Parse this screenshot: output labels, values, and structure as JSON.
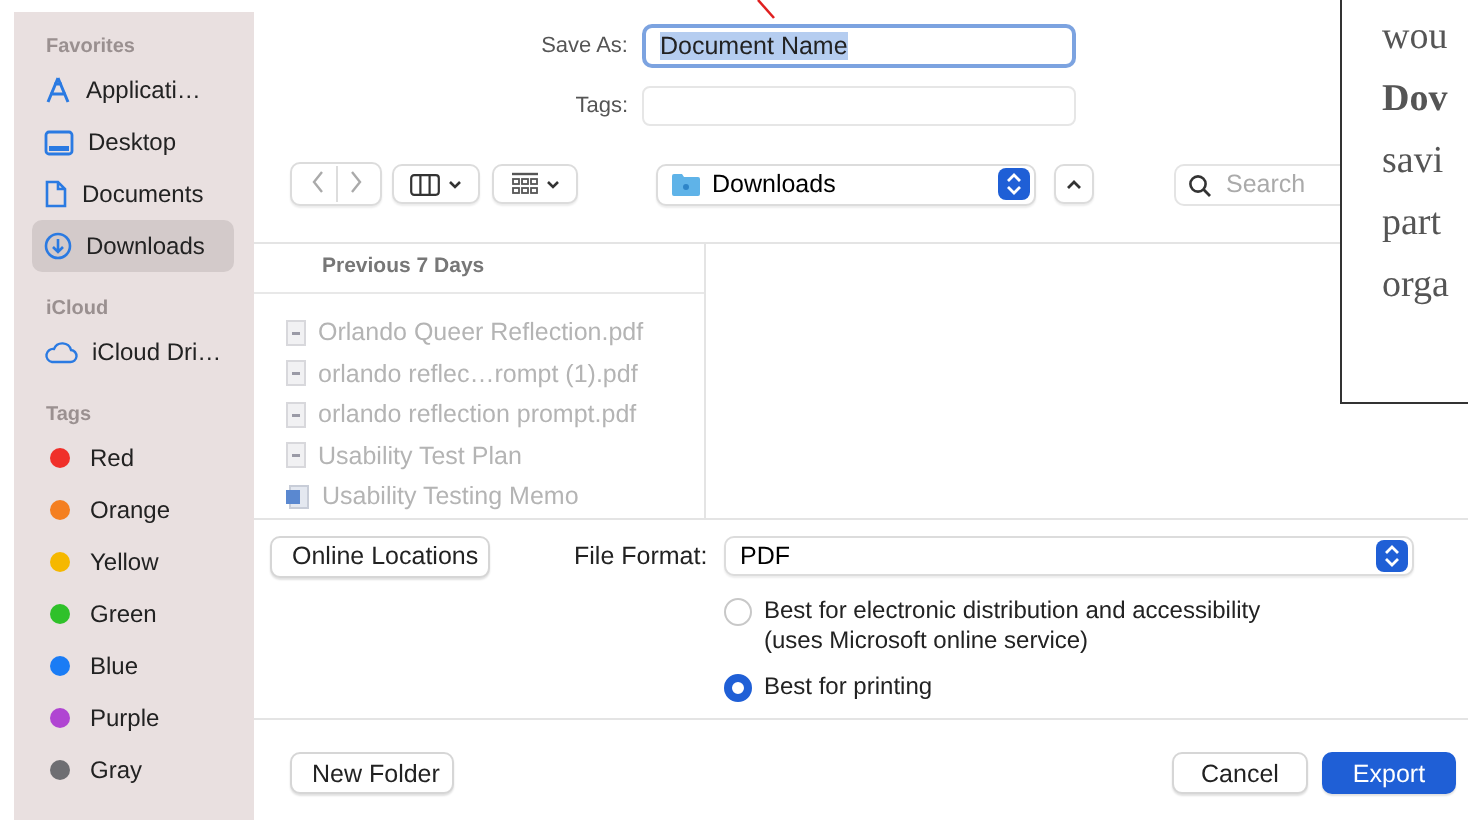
{
  "sidebar": {
    "sections": [
      {
        "title": "Favorites",
        "items": [
          {
            "label": "Applicati…",
            "kind": "apps",
            "selected": false
          },
          {
            "label": "Desktop",
            "kind": "desktop",
            "selected": false
          },
          {
            "label": "Documents",
            "kind": "doc",
            "selected": false
          },
          {
            "label": "Downloads",
            "kind": "download",
            "selected": true
          }
        ]
      },
      {
        "title": "iCloud",
        "items": [
          {
            "label": "iCloud Dri…",
            "kind": "cloud",
            "selected": false
          }
        ]
      },
      {
        "title": "Tags",
        "items": [
          {
            "label": "Red",
            "kind": "tag",
            "color": "#f0302a",
            "selected": false
          },
          {
            "label": "Orange",
            "kind": "tag",
            "color": "#f47f20",
            "selected": false
          },
          {
            "label": "Yellow",
            "kind": "tag",
            "color": "#f5b800",
            "selected": false
          },
          {
            "label": "Green",
            "kind": "tag",
            "color": "#2fc12a",
            "selected": false
          },
          {
            "label": "Blue",
            "kind": "tag",
            "color": "#1a7cf5",
            "selected": false
          },
          {
            "label": "Purple",
            "kind": "tag",
            "color": "#b045d2",
            "selected": false
          },
          {
            "label": "Gray",
            "kind": "tag",
            "color": "#6e6e72",
            "selected": false
          }
        ]
      }
    ]
  },
  "save_as": {
    "label": "Save As:",
    "value": "Document Name"
  },
  "tags": {
    "label": "Tags:"
  },
  "location": {
    "value": "Downloads"
  },
  "search": {
    "placeholder": "Search"
  },
  "browser": {
    "group_title": "Previous 7 Days",
    "files": [
      {
        "name": "Orlando Queer Reflection.pdf",
        "kind": "pdf",
        "disabled": true
      },
      {
        "name": "orlando reflec…rompt (1).pdf",
        "kind": "pdf",
        "disabled": true
      },
      {
        "name": "orlando reflection prompt.pdf",
        "kind": "pdf",
        "disabled": true
      },
      {
        "name": "Usability Test Plan",
        "kind": "pdf",
        "disabled": true
      },
      {
        "name": "Usability Testing Memo",
        "kind": "word",
        "disabled": true
      }
    ]
  },
  "online_locations": "Online Locations",
  "file_format": {
    "label": "File Format:",
    "value": "PDF"
  },
  "options": [
    {
      "label": "Best for electronic distribution and accessibility",
      "note": "(uses Microsoft online service)",
      "selected": false
    },
    {
      "label": "Best for printing",
      "selected": true
    }
  ],
  "footer": {
    "new_folder": "New Folder",
    "cancel": "Cancel",
    "export": "Export"
  },
  "note": {
    "lines": [
      {
        "text": "wou",
        "bold": false
      },
      {
        "text": "Dov",
        "bold": true
      },
      {
        "text": "savi",
        "bold": false
      },
      {
        "text": "part",
        "bold": false
      },
      {
        "text": "orga",
        "bold": false
      }
    ]
  }
}
